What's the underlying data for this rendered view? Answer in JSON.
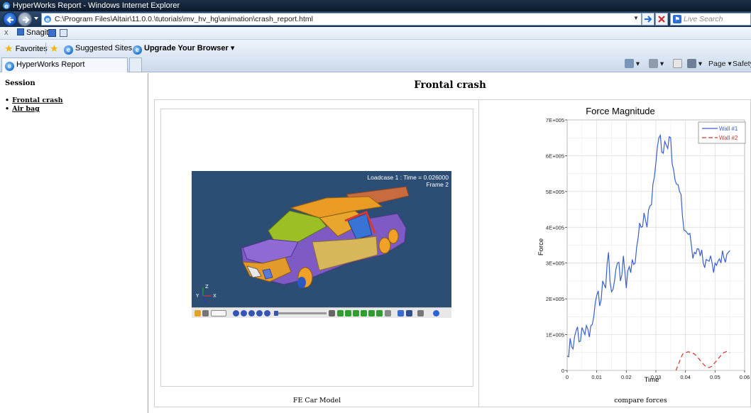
{
  "window": {
    "title": "HyperWorks Report - Windows Internet Explorer"
  },
  "address": {
    "url": "C:\\Program Files\\Altair\\11.0.0.\\tutorials\\mv_hv_hg\\animation\\crash_report.html",
    "search_placeholder": "Live Search"
  },
  "snagit": {
    "close": "x",
    "label": "Snagit"
  },
  "favorites": {
    "favorites_label": "Favorites",
    "suggested_label": "Suggested Sites ▾",
    "upgrade_label": "Upgrade Your Browser ▾"
  },
  "tabs": {
    "active_label": "HyperWorks Report"
  },
  "commandbar": {
    "page_label": "Page ▾",
    "safety_label": "Safety"
  },
  "sidebar": {
    "heading": "Session",
    "items": [
      {
        "label": "Frontal crash"
      },
      {
        "label": "Air bag"
      }
    ]
  },
  "main": {
    "title": "Frontal crash",
    "left_caption": "FE Car Model",
    "right_caption": "compare forces",
    "viewer": {
      "loadcase_line1": "Loadcase 1 : Time = 0.026000",
      "loadcase_line2": "Frame 2",
      "triad_z": "Z",
      "triad_y": "Y",
      "triad_x": "X"
    }
  },
  "colors": {
    "accent": "#1f5fd6",
    "series1": "#3a5fcf",
    "series2": "#d0352b",
    "viewer_bg": "#2d4e74"
  },
  "chart_data": {
    "type": "line",
    "title": "Force Magnitude",
    "xlabel": "Time",
    "ylabel": "Force",
    "xlim": [
      0,
      0.06
    ],
    "ylim": [
      0,
      700000
    ],
    "xticks": [
      "0",
      "0.01",
      "0.02",
      "0.03",
      "0.04",
      "0.05",
      "0.06"
    ],
    "yticks": [
      "0",
      "1E+005",
      "2E+005",
      "3E+005",
      "4E+005",
      "5E+005",
      "6E+005",
      "7E+005"
    ],
    "grid": true,
    "legend_position": "top-right",
    "series": [
      {
        "name": "Wall #1",
        "color": "#3a5fcf",
        "style": "solid",
        "x": [
          0,
          0.001,
          0.002,
          0.003,
          0.004,
          0.005,
          0.006,
          0.007,
          0.008,
          0.009,
          0.01,
          0.011,
          0.012,
          0.013,
          0.014,
          0.015,
          0.016,
          0.017,
          0.018,
          0.019,
          0.02,
          0.021,
          0.022,
          0.023,
          0.024,
          0.025,
          0.026,
          0.027,
          0.028,
          0.029,
          0.03,
          0.031,
          0.032,
          0.033,
          0.034,
          0.035,
          0.036,
          0.037,
          0.038,
          0.039,
          0.04,
          0.041,
          0.042,
          0.043,
          0.044,
          0.045,
          0.046,
          0.047,
          0.048,
          0.049,
          0.05,
          0.051,
          0.052,
          0.053,
          0.054,
          0.055
        ],
        "y": [
          40000,
          90000,
          60000,
          110000,
          80000,
          120000,
          100000,
          115000,
          125000,
          150000,
          210000,
          180000,
          250000,
          230000,
          330000,
          220000,
          250000,
          300000,
          250000,
          320000,
          230000,
          290000,
          310000,
          300000,
          370000,
          400000,
          440000,
          400000,
          460000,
          520000,
          580000,
          650000,
          610000,
          640000,
          620000,
          650000,
          560000,
          520000,
          500000,
          430000,
          390000,
          380000,
          350000,
          330000,
          340000,
          320000,
          300000,
          310000,
          305000,
          300000,
          300000,
          305000,
          300000,
          315000,
          325000,
          335000
        ]
      },
      {
        "name": "Wall #2",
        "color": "#d0352b",
        "style": "dashed",
        "x": [
          0.0368,
          0.038,
          0.039,
          0.04,
          0.041,
          0.042,
          0.043,
          0.044,
          0.045,
          0.046,
          0.047,
          0.048,
          0.049,
          0.05,
          0.051,
          0.052,
          0.053,
          0.054,
          0.055
        ],
        "y": [
          0,
          25000,
          45000,
          50000,
          52000,
          50000,
          46000,
          38000,
          28000,
          18000,
          10000,
          8000,
          12000,
          22000,
          32000,
          42000,
          50000,
          53000,
          50000
        ]
      }
    ]
  }
}
